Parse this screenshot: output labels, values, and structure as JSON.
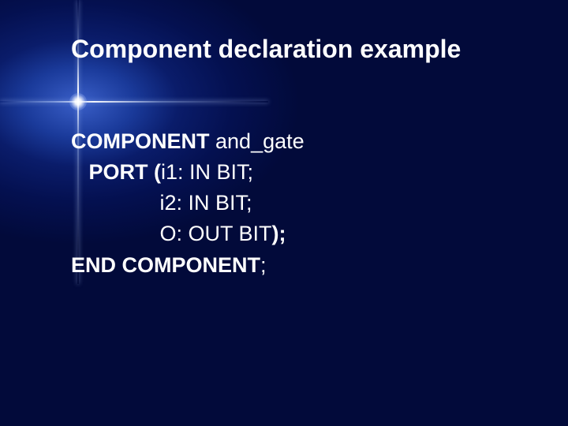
{
  "title": "Component declaration example",
  "code": {
    "l1_kw": "COMPONENT ",
    "l1_rest": "and_gate",
    "l2_kw": "   PORT (",
    "l2_rest": "i1: IN BIT;",
    "l3": "               i2: IN BIT;",
    "l4_rest": "               O: OUT BIT",
    "l4_kw": ");",
    "l5_kw": "END COMPONENT",
    "l5_rest": ";"
  }
}
